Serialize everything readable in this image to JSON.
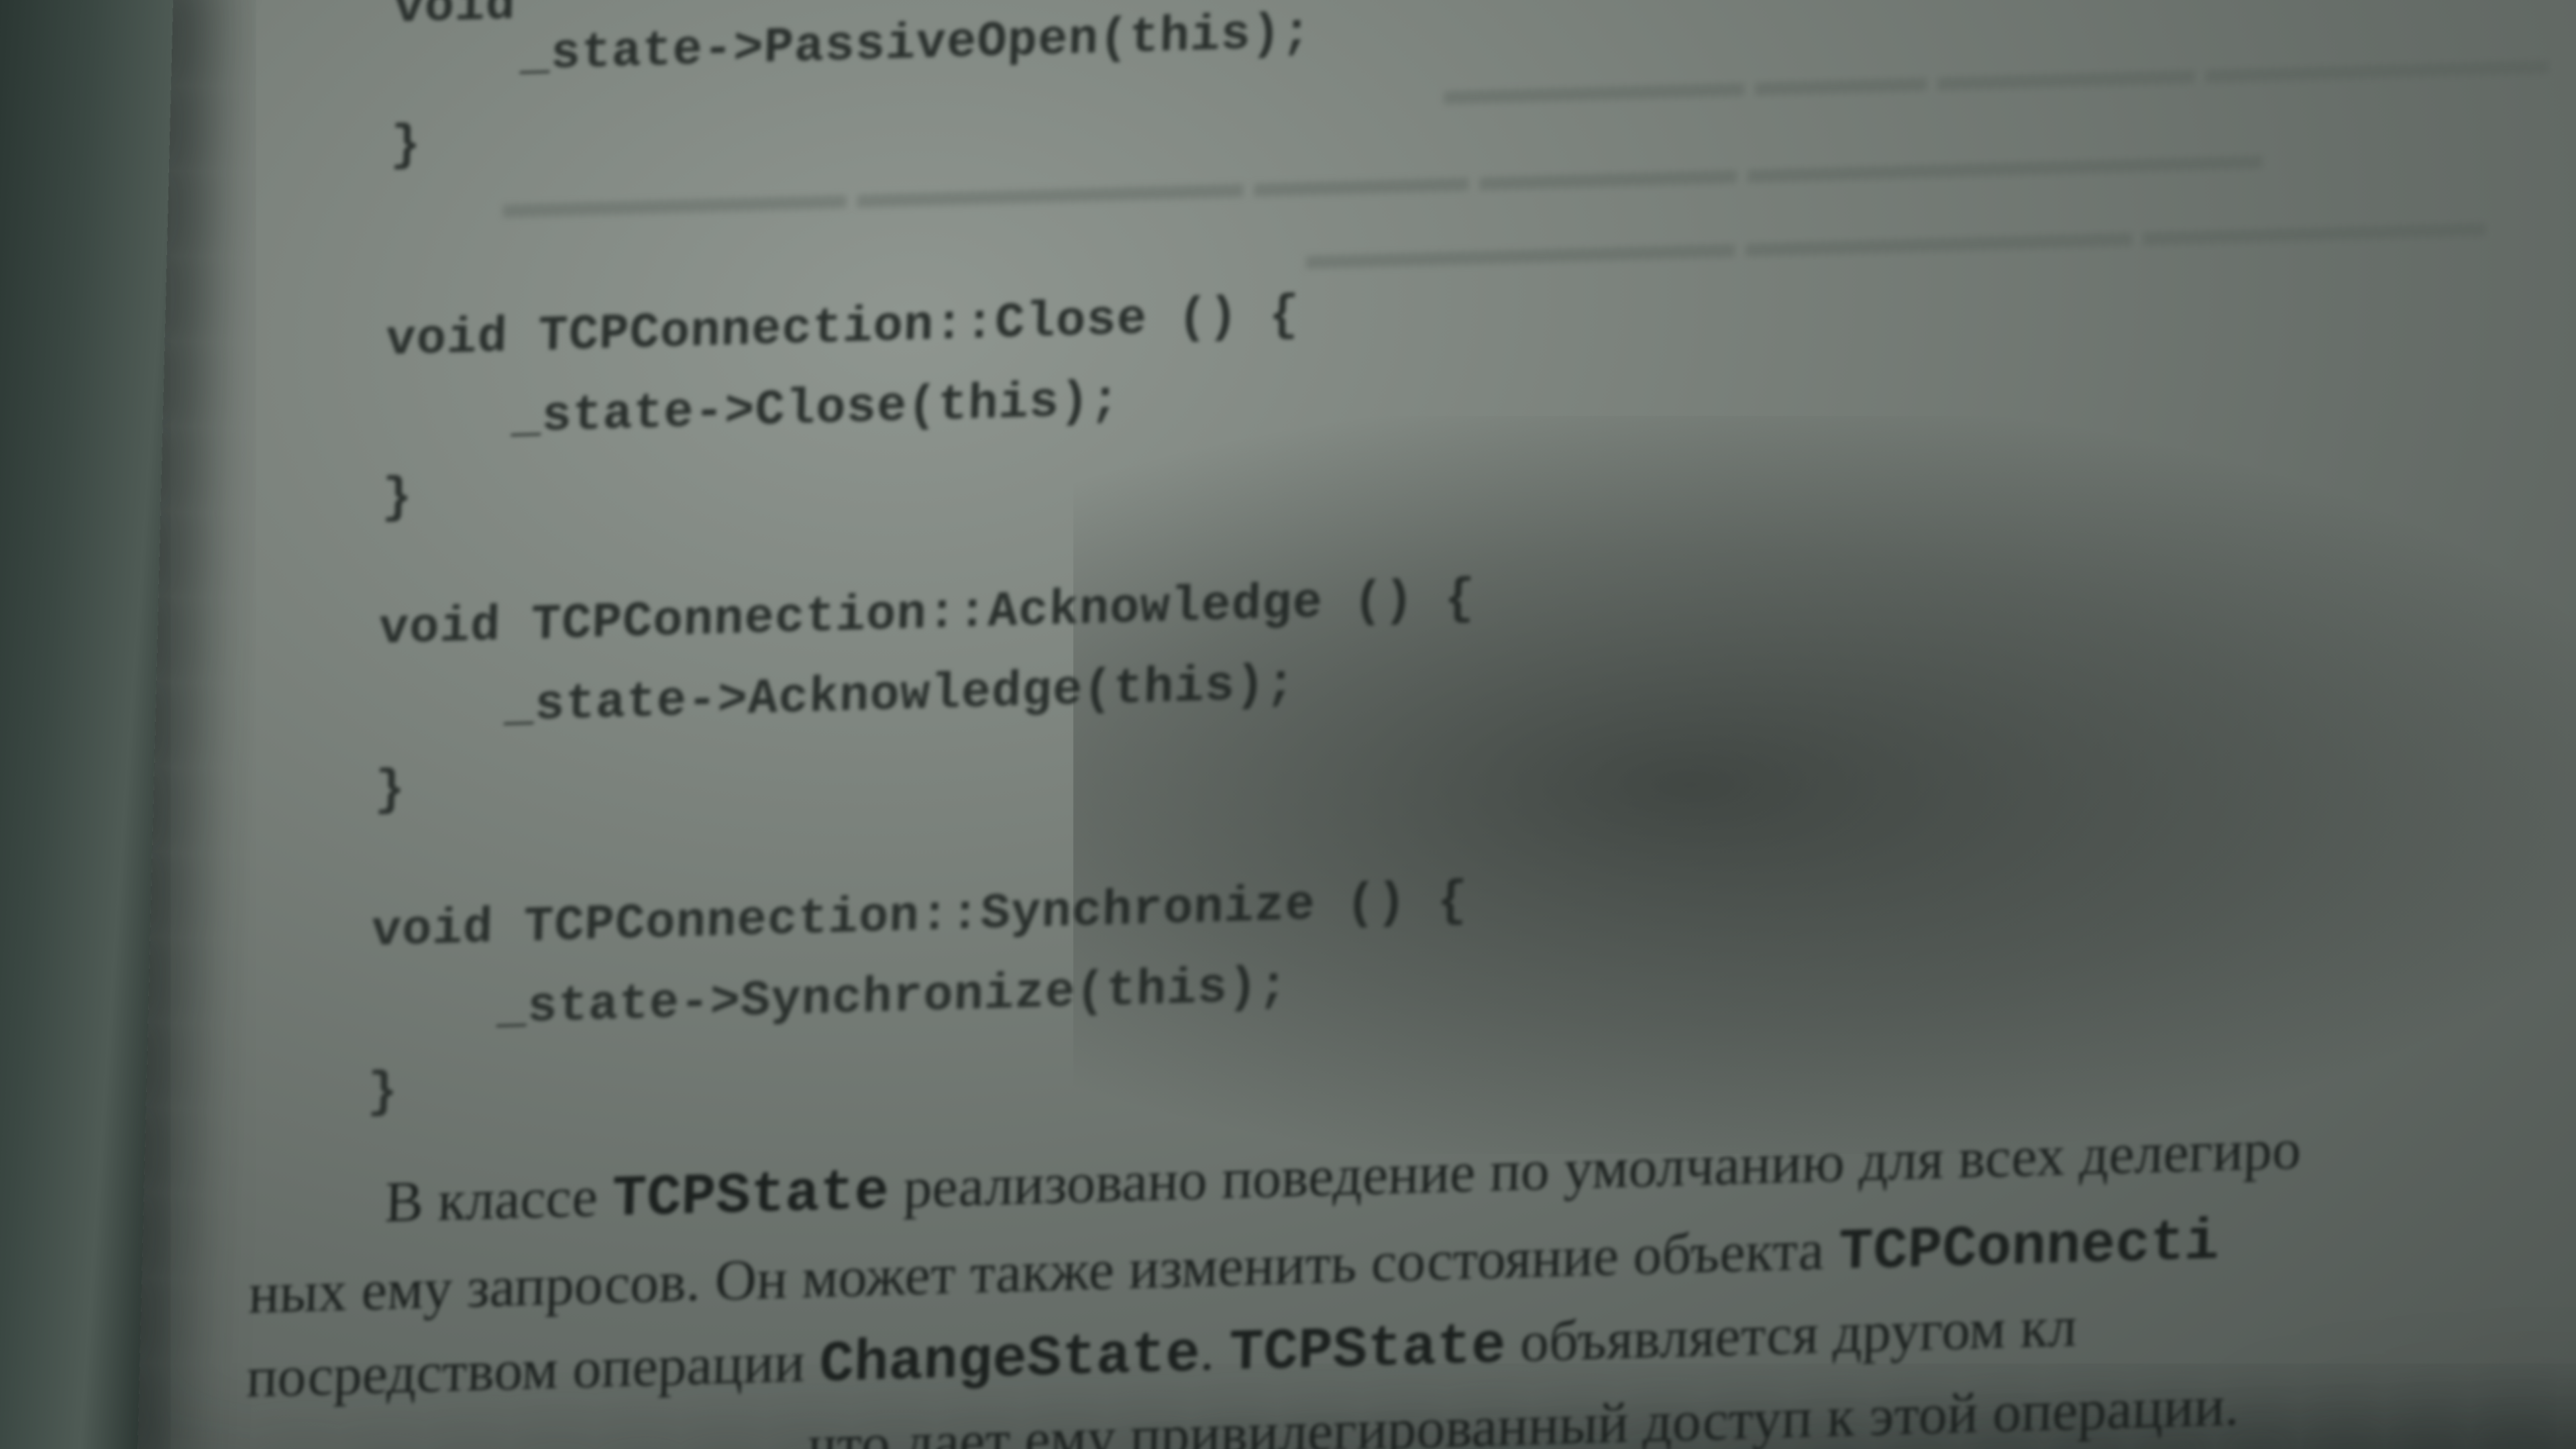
{
  "code": {
    "top_line_1": "void",
    "top_line_2": "_state->PassiveOpen(this);",
    "top_line_3": "}",
    "close_sig": "void TCPConnection::Close () {",
    "close_body": "_state->Close(this);",
    "close_end": "}",
    "ack_sig": "void TCPConnection::Acknowledge () {",
    "ack_body": "_state->Acknowledge(this);",
    "ack_end": "}",
    "sync_sig": "void TCPConnection::Synchronize () {",
    "sync_body": "_state->Synchronize(this);",
    "sync_end": "}"
  },
  "paragraph": {
    "line1_a": "В классе ",
    "line1_code": "TCPState",
    "line1_b": " реализовано поведение по умолчанию для всех делегиро",
    "line2_a": "ных ему запросов. Он может также изменить состояние объекта ",
    "line2_code": "TCPConnecti",
    "line3_a": "посредством операции ",
    "line3_code1": "ChangeState",
    "line3_b": ". ",
    "line3_code2": "TCPState",
    "line3_c": " объявляется другом кл",
    "line4_a": "что дает ему привилегированный доступ к этой операции."
  }
}
